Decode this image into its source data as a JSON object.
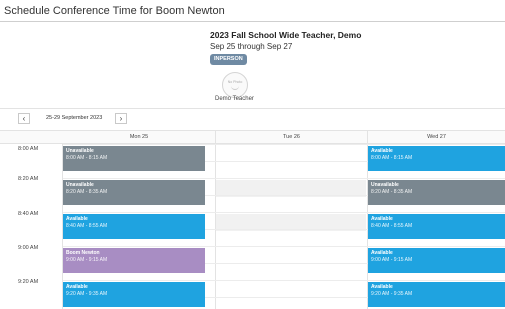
{
  "dialog": {
    "title": "Schedule Conference Time for Boom Newton"
  },
  "event": {
    "title": "2023 Fall School Wide  Teacher, Demo",
    "dates": "Sep 25 through Sep 27",
    "mode_badge": "INPERSON",
    "avatar_text": "No Photo",
    "teacher_name": "Demo Teacher"
  },
  "nav": {
    "prev_icon": "chevron-left-icon",
    "next_icon": "chevron-right-icon",
    "week_label": "25-29 September 2023"
  },
  "days": [
    "Mon 25",
    "Tue 26",
    "Wed 27"
  ],
  "time_labels": [
    "8:00 AM",
    "8:20 AM",
    "8:40 AM",
    "9:00 AM",
    "9:20 AM"
  ],
  "colors": {
    "unavailable": "#7a8790",
    "available": "#1fa3e0",
    "booked": "#a88dc3"
  },
  "slots": {
    "mon": [
      {
        "title": "Unavailable",
        "time": "8:00 AM - 8:15 AM"
      },
      {
        "title": "Unavailable",
        "time": "8:20 AM - 8:35 AM"
      },
      {
        "title": "Available",
        "time": "8:40 AM - 8:55 AM"
      },
      {
        "title": "Boom Newton",
        "time": "9:00 AM - 9:15 AM"
      },
      {
        "title": "Available",
        "time": "9:20 AM - 9:35 AM"
      }
    ],
    "wed": [
      {
        "title": "Available",
        "time": "8:00 AM - 8:15 AM"
      },
      {
        "title": "Unavailable",
        "time": "8:20 AM - 8:35 AM"
      },
      {
        "title": "Available",
        "time": "8:40 AM - 8:55 AM"
      },
      {
        "title": "Available",
        "time": "9:00 AM - 9:15 AM"
      },
      {
        "title": "Available",
        "time": "9:20 AM - 9:35 AM"
      }
    ]
  }
}
